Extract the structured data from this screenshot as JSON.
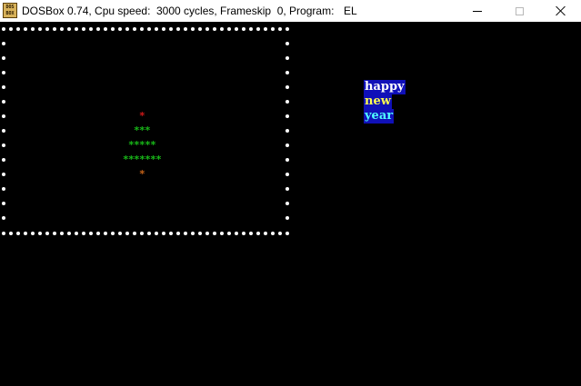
{
  "window": {
    "icon_text": "DOS BOX",
    "title_app": "DOSBox 0.74, Cpu speed:",
    "title_cycles": "3000 cycles, Frameskip  0, Program:",
    "title_program": "EL"
  },
  "tree": {
    "rows": [
      {
        "text": "*",
        "color": "#d01818"
      },
      {
        "text": "***",
        "color": "#18b818"
      },
      {
        "text": "*****",
        "color": "#18b818"
      },
      {
        "text": "*******",
        "color": "#18b818"
      },
      {
        "text": "*",
        "color": "#c86418"
      }
    ]
  },
  "greeting": {
    "lines": [
      {
        "text": "happy",
        "fg": "#ffffff",
        "bg": "#1010b8"
      },
      {
        "text": "new",
        "fg": "#ffff50",
        "bg": "#1010b8"
      },
      {
        "text": "year",
        "fg": "#50ffff",
        "bg": "#1010b8"
      }
    ]
  },
  "frame": {
    "dot_color": "#ffffff"
  }
}
